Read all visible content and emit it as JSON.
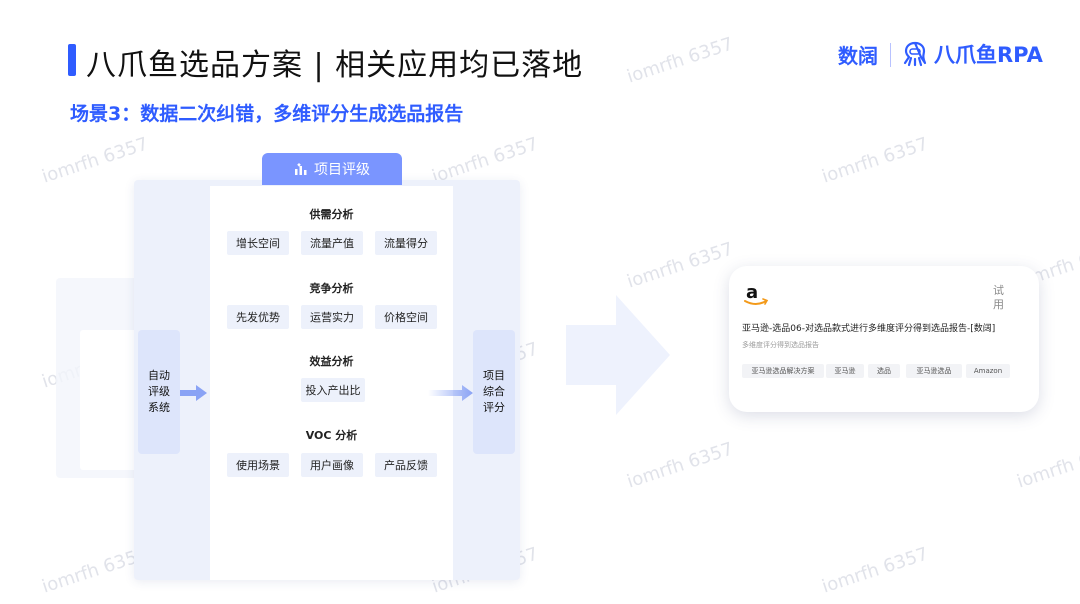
{
  "header": {
    "title": "八爪鱼选品方案 | 相关应用均已落地",
    "subtitle": "场景3：数据二次纠错，多维评分生成选品报告",
    "logo_shuju": "数阔",
    "logo_bazhua": "八爪鱼RPA"
  },
  "diagram": {
    "tab_label": "项目评级",
    "left_box": [
      "自动",
      "评级",
      "系统"
    ],
    "right_box": [
      "项目",
      "综合",
      "评分"
    ],
    "sections": [
      {
        "title": "供需分析",
        "chips": [
          "增长空间",
          "流量产值",
          "流量得分"
        ]
      },
      {
        "title": "竞争分析",
        "chips": [
          "先发优势",
          "运营实力",
          "价格空间"
        ]
      },
      {
        "title": "效益分析",
        "chips": [
          "投入产出比"
        ]
      },
      {
        "title": "VOC 分析",
        "chips": [
          "使用场景",
          "用户画像",
          "产品反馈"
        ]
      }
    ]
  },
  "result_card": {
    "trial": "试用",
    "title": "亚马逊-选品06-对选品款式进行多维度评分得到选品报告-[数阔]",
    "description": "多维度评分得到选品报告",
    "tags": [
      "亚马逊选品解决方案",
      "亚马逊",
      "选品",
      "亚马逊选品",
      "Amazon"
    ]
  },
  "watermark": "iomrfh 6357",
  "colors": {
    "accent": "#2f5cff",
    "tab": "#7a95ff",
    "panel": "#edf1fb",
    "side": "#dde5fb"
  }
}
